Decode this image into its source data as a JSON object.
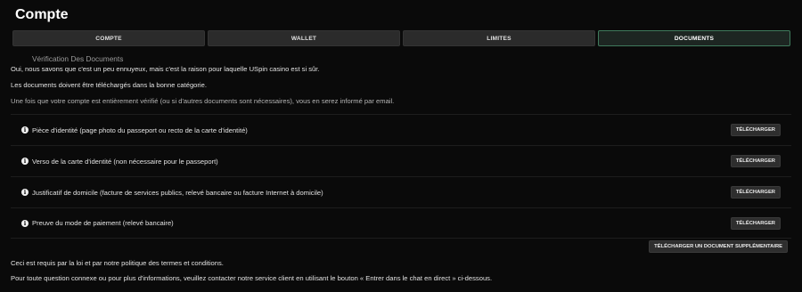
{
  "page": {
    "title": "Compte"
  },
  "tabs": [
    {
      "label": "COMPTE",
      "active": false
    },
    {
      "label": "WALLET",
      "active": false
    },
    {
      "label": "LIMITES",
      "active": false
    },
    {
      "label": "DOCUMENTS",
      "active": true
    }
  ],
  "section": {
    "title": "Vérification Des Documents",
    "intro": "Oui, nous savons que c'est un peu ennuyeux, mais c'est la raison pour laquelle USpin casino est si sûr.",
    "upload_note": "Les documents doivent être téléchargés dans la bonne catégorie.",
    "email_note": "Une fois que votre compte est entièrement vérifié (ou si d'autres documents sont nécessaires), vous en serez informé par email."
  },
  "documents": [
    {
      "label": "Pièce d'identité (page photo du passeport ou recto de la carte d'identité)",
      "button": "TÉLÉCHARGER"
    },
    {
      "label": "Verso de la carte d'identité (non nécessaire pour le passeport)",
      "button": "TÉLÉCHARGER"
    },
    {
      "label": "Justificatif de domicile (facture de services publics, relevé bancaire ou facture Internet à domicile)",
      "button": "TÉLÉCHARGER"
    },
    {
      "label": "Preuve du mode de paiement (relevé bancaire)",
      "button": "TÉLÉCHARGER"
    }
  ],
  "extra_button": "TÉLÉCHARGER UN DOCUMENT SUPPLÉMENTAIRE",
  "footer": {
    "legal": "Ceci est requis par la loi et par notre politique des termes et conditions.",
    "contact": "Pour toute question connexe ou pour plus d'informations, veuillez contacter notre service client en utilisant le bouton « Entrer dans le chat en direct » ci-dessous."
  },
  "colors": {
    "active_tab_border": "#3f7a5c",
    "background": "#0a0a0a"
  },
  "icons": {
    "document_info": "info-icon"
  }
}
